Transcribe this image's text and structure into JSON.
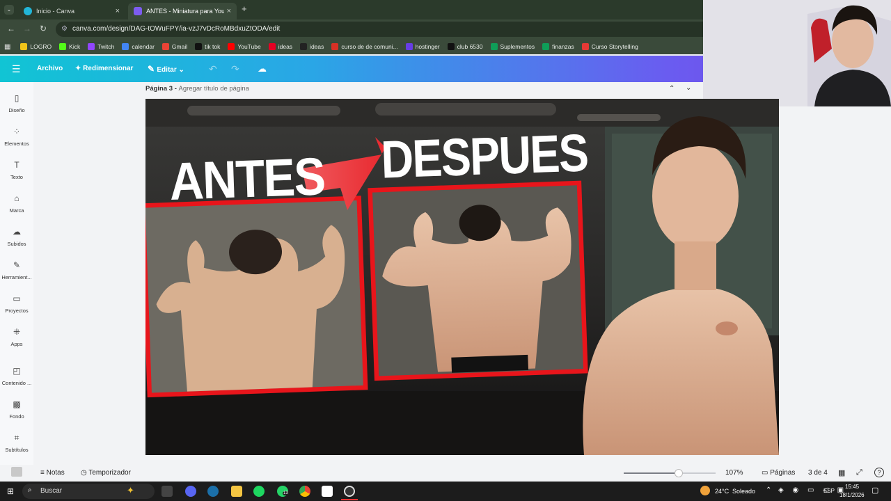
{
  "browser": {
    "tabs": [
      {
        "label": "Inicio - Canva",
        "active": false
      },
      {
        "label": "ANTES - Miniatura para YouTub",
        "active": true
      }
    ],
    "url": "canva.com/design/DAG-tOWuFPY/ia-vzJ7vDcRoMBdxuZtODA/edit",
    "bookmarks": [
      {
        "label": "LOGRO",
        "color": "#f0c419"
      },
      {
        "label": "Kick",
        "color": "#53fc18"
      },
      {
        "label": "Twitch",
        "color": "#9146ff"
      },
      {
        "label": "calendar",
        "color": "#4285f4"
      },
      {
        "label": "Gmail",
        "color": "#ea4335"
      },
      {
        "label": "tik tok",
        "color": "#111111"
      },
      {
        "label": "YouTube",
        "color": "#ff0000"
      },
      {
        "label": "ideas",
        "color": "#e60023"
      },
      {
        "label": "ideas",
        "color": "#222222"
      },
      {
        "label": "curso de de comuni...",
        "color": "#d93025"
      },
      {
        "label": "hostinger",
        "color": "#673de6"
      },
      {
        "label": "club 6530",
        "color": "#111111"
      },
      {
        "label": "Suplementos",
        "color": "#0f9d58"
      },
      {
        "label": "finanzas",
        "color": "#0f9d58"
      },
      {
        "label": "Curso Storytelling",
        "color": "#e53935"
      }
    ]
  },
  "toolbar": {
    "file": "Archivo",
    "resize": "Redimensionar",
    "edit": "Editar"
  },
  "sidebar": {
    "items": [
      {
        "label": "Diseño",
        "icon": "layout-icon"
      },
      {
        "label": "Elementos",
        "icon": "shapes-icon"
      },
      {
        "label": "Texto",
        "icon": "text-icon"
      },
      {
        "label": "Marca",
        "icon": "brand-icon"
      },
      {
        "label": "Subidos",
        "icon": "upload-icon"
      },
      {
        "label": "Herramient...",
        "icon": "tools-icon"
      },
      {
        "label": "Proyectos",
        "icon": "folder-icon"
      },
      {
        "label": "Apps",
        "icon": "apps-icon"
      },
      {
        "label": "Contenido ...",
        "icon": "content-icon"
      },
      {
        "label": "Fondo",
        "icon": "background-icon"
      },
      {
        "label": "Subtítulos",
        "icon": "captions-icon"
      }
    ]
  },
  "page": {
    "title": "Página 3 - ",
    "subtitle": "Agregar título de página"
  },
  "design": {
    "left_text": "ANTES",
    "right_text": "DESPUES",
    "accent": "#e8151b"
  },
  "bottombar": {
    "notes": "Notas",
    "timer": "Temporizador",
    "zoom": "107%",
    "zoom_fraction": 0.6,
    "pages_label": "Páginas",
    "page_count": "3 de 4"
  },
  "taskbar": {
    "search": "Buscar",
    "weather": "24°C",
    "weather_desc": "Soleado",
    "lang": "ESP",
    "time": "15:45",
    "date": "18/1/2026",
    "whatsapp_badge": "13"
  }
}
